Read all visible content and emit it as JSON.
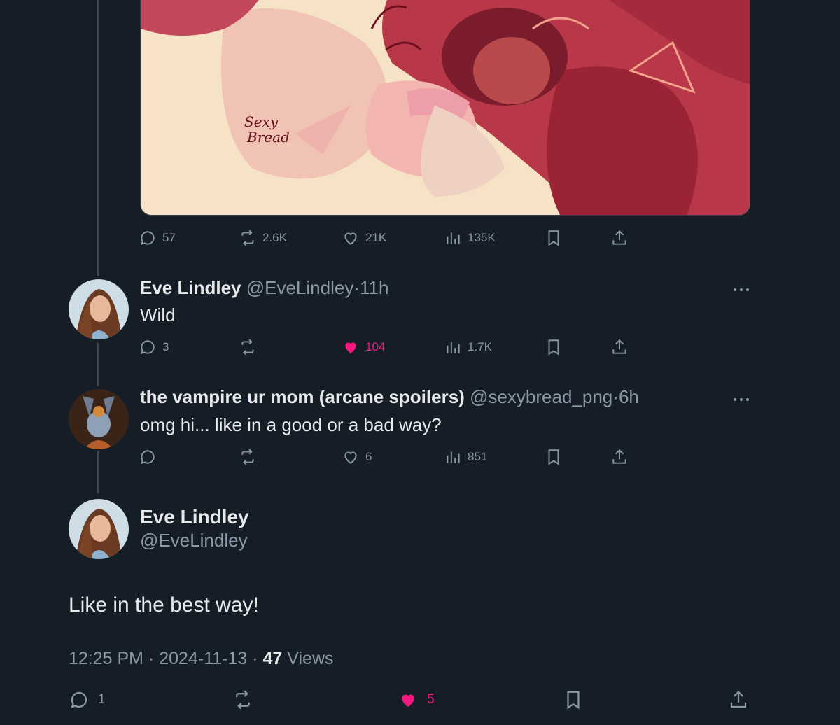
{
  "media": {
    "signature": [
      "Sexy",
      "Bread"
    ]
  },
  "actions_1": {
    "replies": "57",
    "reposts": "2.6K",
    "likes": "21K",
    "views": "135K"
  },
  "reply_1": {
    "name": "Eve Lindley",
    "handle": "@EveLindley",
    "time": "11h",
    "text": "Wild",
    "replies": "3",
    "likes": "104",
    "views": "1.7K"
  },
  "reply_2": {
    "name": "the vampire ur mom (arcane spoilers)",
    "handle": "@sexybread_png",
    "time": "6h",
    "text": "omg hi... like in a good or a bad way?",
    "likes": "6",
    "views": "851"
  },
  "main": {
    "name": "Eve Lindley",
    "handle": "@EveLindley",
    "text": "Like in the best way!",
    "time": "12:25 PM",
    "date": "2024-11-13",
    "views_count": "47",
    "views_label": "Views",
    "replies": "1",
    "likes": "5"
  },
  "separator": "·",
  "colors": {
    "background": "#151d27",
    "muted": "#8b98a5",
    "like": "#f91880",
    "thread_line": "#3b4654"
  },
  "icons": [
    "reply-icon",
    "repost-icon",
    "heart-icon",
    "views-icon",
    "bookmark-icon",
    "share-icon",
    "more-icon"
  ]
}
